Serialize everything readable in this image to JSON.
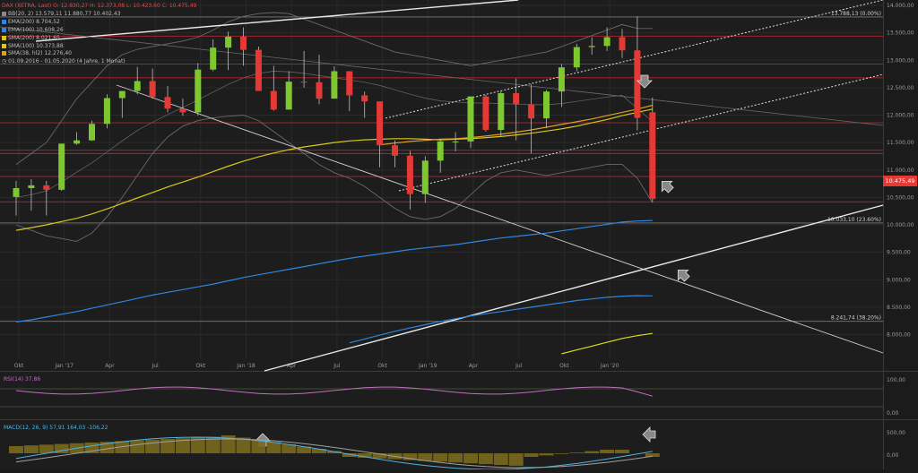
{
  "legend": {
    "title": "DAX (XETRA, Last)  O: 12.830,27  H: 12.373,08  L: 10.423,60  C: 10.475,49",
    "rows": [
      {
        "text": "BB(20, 2)  13.579,11  11.880,77  10.402,43",
        "color": "#8a8a8a"
      },
      {
        "text": "EMA(200)  8.704,52",
        "color": "#2e86de"
      },
      {
        "text": "EMA(100)  10.608,26",
        "color": "#2e86de"
      },
      {
        "text": "SMA(200)  8.021,65",
        "color": "#d8c81a"
      },
      {
        "text": "SMA(100)  10.373,88",
        "color": "#d8c81a"
      },
      {
        "text": "SMA(38, hl2)  12.276,40",
        "color": "#e0a020"
      }
    ],
    "range": "01.09.2016 - 01.05.2020  (4 Jahre, 1 Monat)"
  },
  "rsi_label": "RSI(14)  37,86",
  "macd_label": "MACD(12, 26, 9)  57,91  164,03  -106,22",
  "last_price_label": "10.475,49",
  "chart_data": {
    "type": "candlestick",
    "title": "DAX (XETRA, Last)",
    "xlabel": "",
    "ylabel": "",
    "ylim": [
      7600,
      14000
    ],
    "y_ticks": [
      "14.000,00",
      "13.500,00",
      "13.000,00",
      "12.500,00",
      "12.000,00",
      "11.500,00",
      "11.000,00",
      "10.500,00",
      "10.000,00",
      "9.500,00",
      "9.000,00",
      "8.500,00",
      "8.000,00"
    ],
    "y_tick_values": [
      14000,
      13500,
      13000,
      12500,
      12000,
      11500,
      11000,
      10500,
      10000,
      9500,
      9000,
      8500,
      8000
    ],
    "x_ticks": [
      {
        "label": "Okt",
        "month": 1
      },
      {
        "label": "Jan '17",
        "month": 4
      },
      {
        "label": "Apr",
        "month": 7
      },
      {
        "label": "Jul",
        "month": 10
      },
      {
        "label": "Okt",
        "month": 13
      },
      {
        "label": "Jan '18",
        "month": 16
      },
      {
        "label": "Apr",
        "month": 19
      },
      {
        "label": "Jul",
        "month": 22
      },
      {
        "label": "Okt",
        "month": 25
      },
      {
        "label": "Jan '19",
        "month": 28
      },
      {
        "label": "Apr",
        "month": 31
      },
      {
        "label": "Jul",
        "month": 34
      },
      {
        "label": "Okt",
        "month": 37
      },
      {
        "label": "Jan '20",
        "month": 40
      }
    ],
    "candles": [
      {
        "o": 10510,
        "h": 10800,
        "l": 10170,
        "c": 10670
      },
      {
        "o": 10670,
        "h": 10830,
        "l": 10260,
        "c": 10720
      },
      {
        "o": 10720,
        "h": 10800,
        "l": 10170,
        "c": 10640
      },
      {
        "o": 10640,
        "h": 11480,
        "l": 10620,
        "c": 11480
      },
      {
        "o": 11480,
        "h": 11690,
        "l": 11460,
        "c": 11540
      },
      {
        "o": 11540,
        "h": 11900,
        "l": 11530,
        "c": 11840
      },
      {
        "o": 11840,
        "h": 12380,
        "l": 11760,
        "c": 12310
      },
      {
        "o": 12310,
        "h": 12430,
        "l": 11950,
        "c": 12440
      },
      {
        "o": 12440,
        "h": 12880,
        "l": 12380,
        "c": 12620
      },
      {
        "o": 12620,
        "h": 12850,
        "l": 12300,
        "c": 12330
      },
      {
        "o": 12330,
        "h": 12530,
        "l": 12050,
        "c": 12120
      },
      {
        "o": 12120,
        "h": 12300,
        "l": 11990,
        "c": 12050
      },
      {
        "o": 12050,
        "h": 12950,
        "l": 11990,
        "c": 12830
      },
      {
        "o": 12830,
        "h": 13380,
        "l": 12800,
        "c": 13230
      },
      {
        "o": 13230,
        "h": 13520,
        "l": 12820,
        "c": 13430
      },
      {
        "o": 13430,
        "h": 13600,
        "l": 12900,
        "c": 13190
      },
      {
        "o": 13190,
        "h": 13250,
        "l": 12800,
        "c": 12440
      },
      {
        "o": 12440,
        "h": 12900,
        "l": 12080,
        "c": 12100
      },
      {
        "o": 12100,
        "h": 12800,
        "l": 12110,
        "c": 12610
      },
      {
        "o": 12610,
        "h": 13170,
        "l": 12500,
        "c": 12600
      },
      {
        "o": 12600,
        "h": 13100,
        "l": 12200,
        "c": 12300
      },
      {
        "o": 12300,
        "h": 12890,
        "l": 12300,
        "c": 12800
      },
      {
        "o": 12800,
        "h": 12740,
        "l": 12070,
        "c": 12360
      },
      {
        "o": 12360,
        "h": 12430,
        "l": 11950,
        "c": 12250
      },
      {
        "o": 12250,
        "h": 12180,
        "l": 11050,
        "c": 11450
      },
      {
        "o": 11450,
        "h": 11540,
        "l": 11050,
        "c": 11260
      },
      {
        "o": 11260,
        "h": 11350,
        "l": 10280,
        "c": 10560
      },
      {
        "o": 10560,
        "h": 11250,
        "l": 10400,
        "c": 11170
      },
      {
        "o": 11170,
        "h": 11570,
        "l": 10950,
        "c": 11520
      },
      {
        "o": 11520,
        "h": 11690,
        "l": 11340,
        "c": 11520
      },
      {
        "o": 11520,
        "h": 12320,
        "l": 11400,
        "c": 12340
      },
      {
        "o": 12340,
        "h": 12370,
        "l": 11700,
        "c": 11730
      },
      {
        "o": 11730,
        "h": 12450,
        "l": 11600,
        "c": 12400
      },
      {
        "o": 12400,
        "h": 12670,
        "l": 11540,
        "c": 12200
      },
      {
        "o": 12200,
        "h": 12560,
        "l": 11300,
        "c": 11940
      },
      {
        "o": 11940,
        "h": 12460,
        "l": 11760,
        "c": 12430
      },
      {
        "o": 12430,
        "h": 12930,
        "l": 12150,
        "c": 12870
      },
      {
        "o": 12870,
        "h": 13300,
        "l": 12800,
        "c": 13240
      },
      {
        "o": 13240,
        "h": 13420,
        "l": 13100,
        "c": 13260
      },
      {
        "o": 13260,
        "h": 13600,
        "l": 13170,
        "c": 13420
      },
      {
        "o": 13420,
        "h": 13570,
        "l": 13040,
        "c": 13180
      },
      {
        "o": 13180,
        "h": 13800,
        "l": 11720,
        "c": 11950
      },
      {
        "o": 12050,
        "h": 12320,
        "l": 10420,
        "c": 10475
      }
    ],
    "levels": [
      {
        "value": 13788.13,
        "label": "13.788,13 (0.00%)",
        "style": "fib"
      },
      {
        "value": 10033.1,
        "label": "10.033,10 (23.60%)",
        "style": "fib"
      },
      {
        "value": 8241.74,
        "label": "8.241,74 (38.20%)",
        "style": "fib"
      },
      {
        "value": 13440,
        "label": "",
        "style": "red"
      },
      {
        "value": 12930,
        "label": "",
        "style": "red"
      },
      {
        "value": 12680,
        "label": "",
        "style": "red"
      },
      {
        "value": 11860,
        "label": "",
        "style": "red"
      },
      {
        "value": 11360,
        "label": "",
        "style": "red"
      },
      {
        "value": 11300,
        "label": "",
        "style": "red"
      },
      {
        "value": 10880,
        "label": "",
        "style": "red"
      },
      {
        "value": 10420,
        "label": "",
        "style": "red"
      }
    ],
    "series": [
      {
        "name": "EMA(200)",
        "color": "#2e86de",
        "values": [
          8230,
          8270,
          8320,
          8370,
          8420,
          8480,
          8540,
          8600,
          8660,
          8720,
          8770,
          8820,
          8870,
          8920,
          8980,
          9040,
          9090,
          9140,
          9190,
          9240,
          9290,
          9340,
          9390,
          9430,
          9470,
          9510,
          9550,
          9580,
          9610,
          9640,
          9680,
          9720,
          9760,
          9790,
          9820,
          9850,
          9890,
          9930,
          9970,
          10010,
          10050,
          10070,
          10080
        ]
      },
      {
        "name": "SMA(100)",
        "color": "#d8c81a",
        "values": [
          9900,
          9950,
          10000,
          10060,
          10120,
          10200,
          10290,
          10390,
          10490,
          10590,
          10690,
          10780,
          10870,
          10970,
          11070,
          11160,
          11240,
          11310,
          11370,
          11420,
          11460,
          11500,
          11530,
          11550,
          11560,
          11570,
          11570,
          11560,
          11550,
          11560,
          11570,
          11590,
          11610,
          11640,
          11670,
          11710,
          11750,
          11800,
          11860,
          11920,
          11990,
          12050,
          12110
        ]
      },
      {
        "name": "SMA(38, hl2)",
        "color": "#e0a020",
        "values": [
          null,
          null,
          null,
          null,
          null,
          null,
          null,
          null,
          null,
          null,
          null,
          null,
          null,
          null,
          null,
          null,
          null,
          null,
          null,
          null,
          null,
          null,
          null,
          null,
          11460,
          11490,
          11520,
          11540,
          11560,
          11570,
          11590,
          11620,
          11650,
          11690,
          11730,
          11780,
          11830,
          11880,
          11930,
          11990,
          12050,
          12110,
          12180
        ]
      },
      {
        "name": "EMA(100) (lower)",
        "color": "#2e86de",
        "values": [
          null,
          null,
          null,
          null,
          null,
          null,
          null,
          null,
          null,
          null,
          null,
          null,
          null,
          null,
          null,
          null,
          null,
          null,
          null,
          null,
          null,
          null,
          7850,
          7920,
          7990,
          8060,
          8120,
          8180,
          8240,
          8290,
          8340,
          8380,
          8420,
          8460,
          8500,
          8540,
          8580,
          8620,
          8650,
          8680,
          8700,
          8710,
          8705
        ]
      },
      {
        "name": "SMA(200)",
        "color": "#d8e01a",
        "values": [
          null,
          null,
          null,
          null,
          null,
          null,
          null,
          null,
          null,
          null,
          null,
          null,
          null,
          null,
          null,
          null,
          null,
          null,
          null,
          null,
          null,
          null,
          null,
          null,
          null,
          null,
          null,
          null,
          null,
          null,
          null,
          null,
          null,
          null,
          null,
          null,
          7650,
          7720,
          7790,
          7860,
          7930,
          7980,
          8022
        ]
      }
    ],
    "bollinger": {
      "upper": [
        11100,
        11300,
        11500,
        11900,
        12300,
        12600,
        12900,
        13100,
        13200,
        13250,
        13300,
        13350,
        13420,
        13550,
        13700,
        13800,
        13850,
        13870,
        13850,
        13750,
        13650,
        13550,
        13450,
        13350,
        13250,
        13150,
        13100,
        13050,
        13000,
        12950,
        12900,
        12950,
        13000,
        13050,
        13100,
        13150,
        13250,
        13350,
        13450,
        13550,
        13650,
        13580,
        13579
      ],
      "lower": [
        10000,
        9900,
        9800,
        9750,
        9700,
        9850,
        10150,
        10500,
        10900,
        11300,
        11600,
        11800,
        11900,
        11950,
        11980,
        12000,
        11900,
        11700,
        11500,
        11300,
        11100,
        10950,
        10850,
        10700,
        10500,
        10300,
        10150,
        10100,
        10150,
        10300,
        10550,
        10800,
        10950,
        11000,
        10950,
        10900,
        10950,
        11000,
        11050,
        11100,
        11100,
        10850,
        10402
      ],
      "middle": [
        10500,
        10550,
        10620,
        10780,
        10960,
        11130,
        11330,
        11530,
        11720,
        11870,
        12010,
        12140,
        12280,
        12420,
        12560,
        12680,
        12760,
        12800,
        12790,
        12760,
        12720,
        12680,
        12640,
        12600,
        12540,
        12460,
        12380,
        12310,
        12260,
        12240,
        12220,
        12220,
        12210,
        12200,
        12190,
        12190,
        12210,
        12250,
        12290,
        12330,
        12360,
        12120,
        11881
      ]
    },
    "rsi": {
      "name": "RSI(14)",
      "ylim": [
        0,
        100
      ],
      "ticks": [
        "100,00",
        "0,00"
      ],
      "last": 37.86
    },
    "macd": {
      "name": "MACD(12, 26, 9)",
      "ticks": [
        "500,00",
        "0,00"
      ],
      "macd_last": 57.91,
      "signal_last": 164.03,
      "hist_last": -106.22
    }
  }
}
